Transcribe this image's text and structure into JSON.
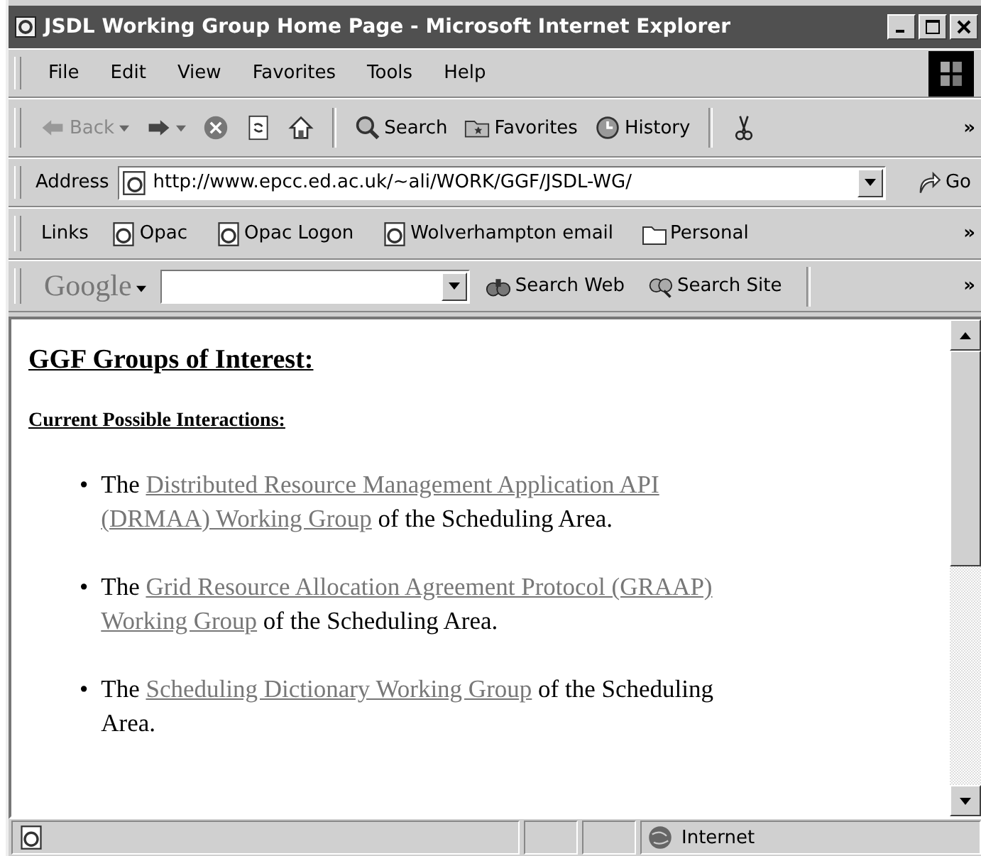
{
  "window": {
    "title": "JSDL Working Group Home Page - Microsoft Internet Explorer"
  },
  "menu": [
    "File",
    "Edit",
    "View",
    "Favorites",
    "Tools",
    "Help"
  ],
  "toolbar": {
    "buttons": [
      {
        "kind": "back",
        "label": "Back",
        "disabled": true
      },
      {
        "kind": "forward",
        "disabled": false
      },
      {
        "kind": "stop"
      },
      {
        "kind": "refresh"
      },
      {
        "kind": "home"
      },
      {
        "kind": "search",
        "label": "Search"
      },
      {
        "kind": "favorites",
        "label": "Favorites"
      },
      {
        "kind": "history",
        "label": "History"
      },
      {
        "kind": "cut"
      }
    ],
    "overflow": "»"
  },
  "address": {
    "label": "Address",
    "value": "http://www.epcc.ed.ac.uk/~ali/WORK/GGF/JSDL-WG/",
    "go": "Go"
  },
  "links": {
    "label": "Links",
    "items": [
      {
        "kind": "page",
        "label": "Opac"
      },
      {
        "kind": "page",
        "label": "Opac Logon"
      },
      {
        "kind": "page",
        "label": "Wolverhampton email"
      },
      {
        "kind": "folder",
        "label": "Personal"
      }
    ],
    "overflow": "»"
  },
  "google": {
    "logo": "Google",
    "buttons": [
      {
        "kind": "web",
        "label": "Search Web"
      },
      {
        "kind": "site",
        "label": "Search Site"
      }
    ],
    "overflow": "»"
  },
  "content": {
    "heading": "GGF Groups of Interest:",
    "subheading": "Current Possible Interactions:",
    "items": [
      {
        "bullet": "•",
        "lines": [
          [
            {
              "kind": "text",
              "text": "The"
            },
            {
              "kind": "link",
              "text": "Distributed Resource Management Application API"
            }
          ],
          [
            {
              "kind": "link",
              "text": "(DRMAA) Working Group"
            },
            {
              "kind": "text",
              "text": "of the Scheduling Area."
            }
          ]
        ]
      },
      {
        "bullet": "•",
        "lines": [
          [
            {
              "kind": "text",
              "text": "The"
            },
            {
              "kind": "link",
              "text": "Grid Resource Allocation Agreement Protocol (GRAAP)"
            }
          ],
          [
            {
              "kind": "link",
              "text": "Working Group"
            },
            {
              "kind": "text",
              "text": "of the Scheduling Area."
            }
          ]
        ]
      },
      {
        "bullet": "•",
        "lines": [
          [
            {
              "kind": "text",
              "text": "The"
            },
            {
              "kind": "link",
              "text": "Scheduling Dictionary Working Group"
            },
            {
              "kind": "text",
              "text": "of the Scheduling"
            }
          ],
          [
            {
              "kind": "text",
              "text": "Area."
            }
          ]
        ]
      }
    ]
  },
  "status_bar": {
    "zone": "Internet"
  }
}
